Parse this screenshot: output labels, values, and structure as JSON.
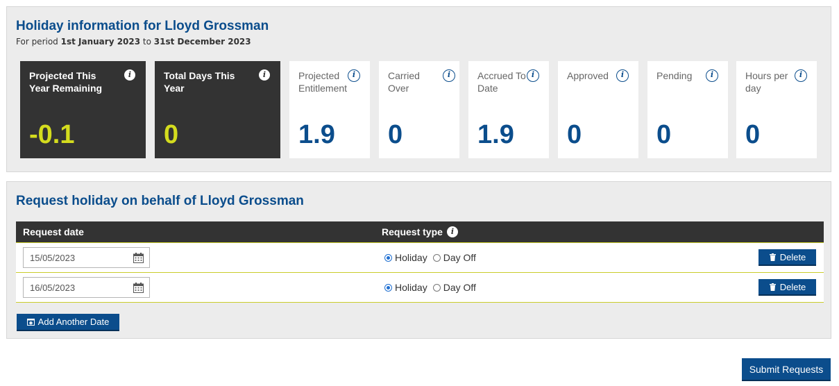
{
  "holiday_info": {
    "title": "Holiday information for Lloyd Grossman",
    "period_prefix": "For period",
    "period_start": "1st January 2023",
    "period_to": "to",
    "period_end": "31st December 2023",
    "cards": [
      {
        "label": "Projected This Year Remaining",
        "value": "-0.1",
        "style": "dark"
      },
      {
        "label": "Total Days This Year",
        "value": "0",
        "style": "dark"
      },
      {
        "label": "Projected Entitlement",
        "value": "1.9",
        "style": "light"
      },
      {
        "label": "Carried Over",
        "value": "0",
        "style": "light"
      },
      {
        "label": "Accrued To Date",
        "value": "1.9",
        "style": "light"
      },
      {
        "label": "Approved",
        "value": "0",
        "style": "light"
      },
      {
        "label": "Pending",
        "value": "0",
        "style": "light"
      },
      {
        "label": "Hours per day",
        "value": "0",
        "style": "light"
      }
    ],
    "info_icon": "info-icon"
  },
  "request": {
    "title": "Request holiday on behalf of Lloyd Grossman",
    "columns": {
      "date": "Request date",
      "type": "Request type"
    },
    "rows": [
      {
        "date": "15/05/2023",
        "type": "Holiday"
      },
      {
        "date": "16/05/2023",
        "type": "Holiday"
      }
    ],
    "type_options": [
      "Holiday",
      "Day Off"
    ],
    "delete_label": "Delete",
    "add_label": "Add Another Date"
  },
  "submit_label": "Submit Requests",
  "colors": {
    "brand": "#0b4d8c",
    "dark_card": "#333333",
    "highlight": "#d4dc1e",
    "row_border": "#c9cc2a"
  }
}
